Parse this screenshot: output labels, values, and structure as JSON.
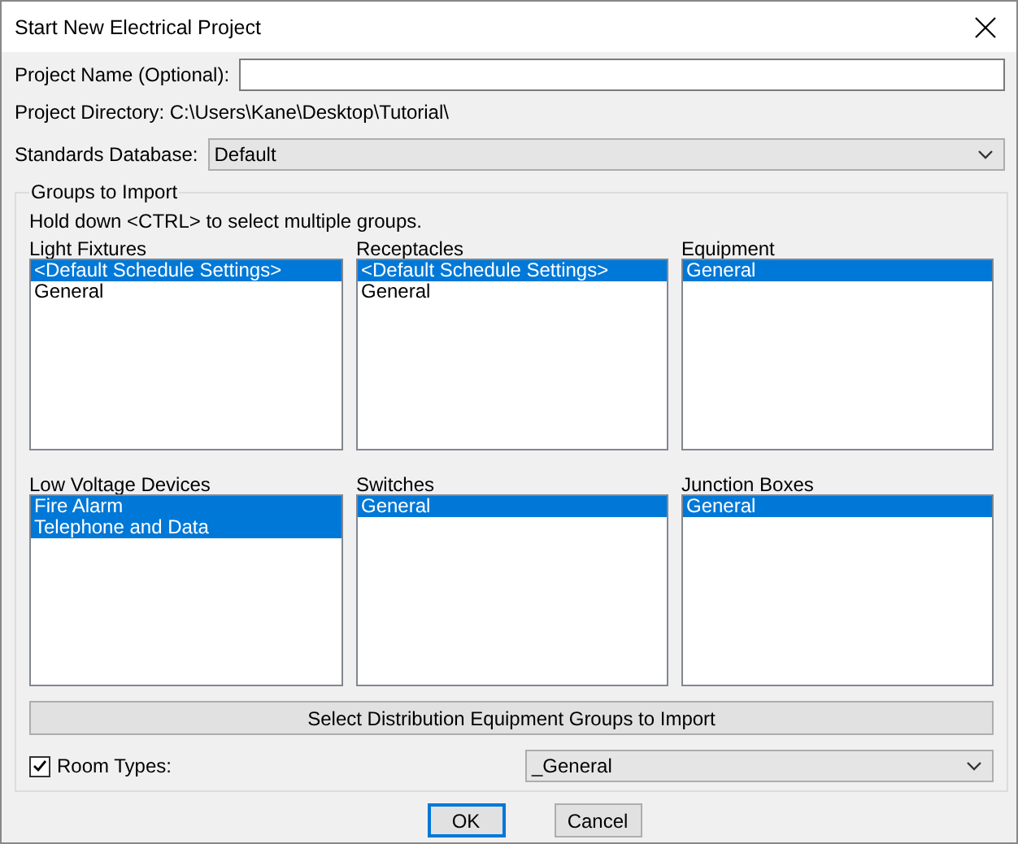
{
  "window": {
    "title": "Start New Electrical Project"
  },
  "project_name": {
    "label": "Project Name (Optional):"
  },
  "project_directory": {
    "text": "Project Directory: C:\\Users\\Kane\\Desktop\\Tutorial\\"
  },
  "standards_database": {
    "label": "Standards Database:",
    "value": "Default"
  },
  "groups_to_import": {
    "title": "Groups to Import",
    "hint": "Hold down <CTRL> to select multiple groups.",
    "groups": [
      {
        "label": "Light Fixtures",
        "items": [
          {
            "text": "<Default Schedule Settings>",
            "selected": true
          },
          {
            "text": "General",
            "selected": false
          }
        ]
      },
      {
        "label": "Receptacles",
        "items": [
          {
            "text": "<Default Schedule Settings>",
            "selected": true
          },
          {
            "text": "General",
            "selected": false
          }
        ]
      },
      {
        "label": "Equipment",
        "items": [
          {
            "text": "General",
            "selected": true
          }
        ]
      },
      {
        "label": "Low Voltage Devices",
        "items": [
          {
            "text": "Fire Alarm",
            "selected": true
          },
          {
            "text": "Telephone and Data",
            "selected": true
          }
        ]
      },
      {
        "label": "Switches",
        "items": [
          {
            "text": "General",
            "selected": true
          }
        ]
      },
      {
        "label": "Junction Boxes",
        "items": [
          {
            "text": "General",
            "selected": true
          }
        ]
      }
    ],
    "distribution_button": "Select Distribution Equipment Groups to Import",
    "room_types": {
      "label": "Room Types:",
      "checked": true,
      "value": "_General"
    }
  },
  "buttons": [
    {
      "label": "OK",
      "default": true
    },
    {
      "label": "Cancel",
      "default": false
    }
  ]
}
